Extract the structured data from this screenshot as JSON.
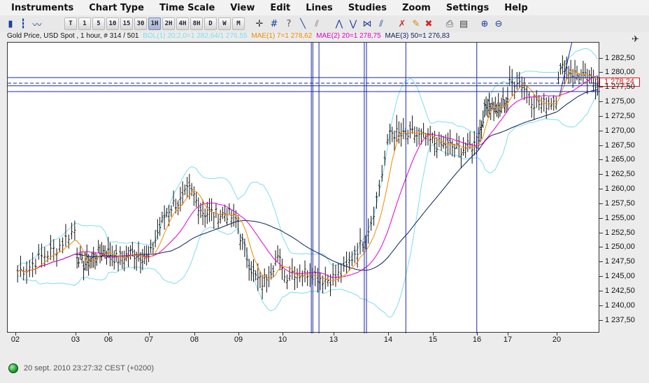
{
  "menubar": {
    "items": [
      "Instruments",
      "Chart Type",
      "Time Scale",
      "View",
      "Edit",
      "Lines",
      "Studies",
      "Zoom",
      "Settings",
      "Help"
    ]
  },
  "toolbar": {
    "timeframes": [
      "T",
      "1",
      "5",
      "10",
      "15",
      "30",
      "1H",
      "2H",
      "4H",
      "8H",
      "D",
      "W",
      "M"
    ],
    "active_timeframe": "1H"
  },
  "legend": {
    "symbol": "Gold Price, USD Spot , 1 hour, # 314 / 501",
    "bol": "BOL(1) 20;2,0=1 282,64/1 276,55",
    "mae1": "MAE(1) 7=1 278,62",
    "mae2": "MAE(2) 20=1 278,75",
    "mae3": "MAE(3) 50=1 276,83",
    "colors": {
      "bol": "#7fdcec",
      "mae1": "#f08a00",
      "mae2": "#e000c8",
      "mae3": "#0a1f5c"
    }
  },
  "price_axis": {
    "labels": [
      "1 282,50",
      "1 280,00",
      "1 277,50",
      "1 275,00",
      "1 272,50",
      "1 270,00",
      "1 267,50",
      "1 265,00",
      "1 262,50",
      "1 260,00",
      "1 257,50",
      "1 255,00",
      "1 252,50",
      "1 250,00",
      "1 247,50",
      "1 245,00",
      "1 242,50",
      "1 240,00",
      "1 237,50"
    ],
    "current_price": "1 278,24"
  },
  "time_axis": {
    "labels": [
      "02",
      "03",
      "06",
      "07",
      "08",
      "09",
      "10",
      "13",
      "14",
      "15",
      "16",
      "17",
      "20"
    ]
  },
  "status": {
    "datetime": "20 sept. 2010 23:27:32  CEST (+0200)"
  },
  "chart_data": {
    "type": "line",
    "title": "Gold Price, USD Spot , 1 hour",
    "xlabel": "",
    "ylabel": "",
    "ylim": [
      1235.3,
      1285.2
    ],
    "x_ticks": [
      "02",
      "03",
      "06",
      "07",
      "08",
      "09",
      "10",
      "13",
      "14",
      "15",
      "16",
      "17",
      "20"
    ],
    "price_path": [
      [
        1246.0,
        1246.5,
        1248.0,
        1249.0,
        1250.0,
        1252.0,
        1253.5
      ],
      [
        1249.0,
        1247.0,
        1247.5,
        1248.5,
        1249.0,
        1249.5,
        1249.0
      ],
      [
        1249.0,
        1248.0,
        1248.5,
        1249.0,
        1249.0,
        1248.5,
        1248.0
      ],
      [
        1249.0,
        1253.0,
        1256.0,
        1257.5,
        1258.0,
        1260.0,
        1258.5
      ],
      [
        1258.0,
        1256.0,
        1256.0,
        1255.5,
        1256.0,
        1255.0,
        1254.5
      ],
      [
        1252.0,
        1248.0,
        1245.0,
        1244.0,
        1246.0,
        1248.0,
        1247.0
      ],
      [
        1245.0,
        1246.0,
        1245.5,
        1246.0,
        1245.0,
        1244.5,
        1245.0
      ],
      [
        1245.0,
        1246.0,
        1249.0,
        1251.0,
        1255.0,
        1262.0,
        1270.0
      ],
      [
        1270.0,
        1269.5,
        1269.0,
        1269.5,
        1269.0,
        1268.5,
        1268.0
      ],
      [
        1268.0,
        1267.5,
        1267.5,
        1267.0,
        1267.0,
        1267.5,
        1268.0
      ],
      [
        1269.0,
        1273.0,
        1275.0,
        1274.0,
        1273.5,
        1275.0,
        1276.0
      ],
      [
        1278.0,
        1279.0,
        1277.0,
        1275.0,
        1274.5,
        1275.0,
        1276.0
      ],
      [
        1280.0,
        1281.0,
        1280.0,
        1279.5,
        1279.0,
        1278.5,
        1278.24
      ]
    ],
    "horizontal_lines": [
      1279.2,
      1278.24,
      1277.8,
      1276.8
    ],
    "vertical_line_days": [
      6.55,
      6.58,
      6.7,
      7.55,
      7.59,
      8.38,
      9.98
    ],
    "indicators": [
      "BOL(1) 20;2,0",
      "MAE(1) 7",
      "MAE(2) 20",
      "MAE(3) 50"
    ],
    "grid": false
  }
}
